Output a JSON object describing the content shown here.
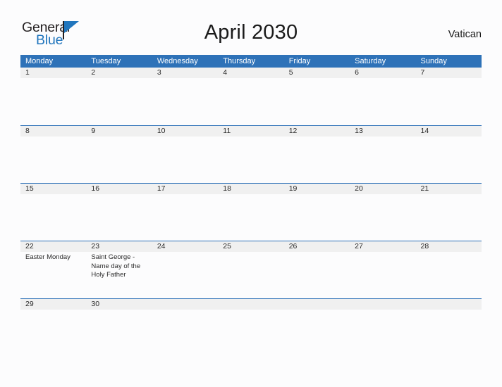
{
  "brand": {
    "name_part1": "General",
    "name_part2": "Blue",
    "flag_icon": "flag-icon"
  },
  "header": {
    "title": "April 2030",
    "country": "Vatican"
  },
  "colors": {
    "header_blue": "#2E72B8",
    "date_band": "#F0F0F0",
    "brand_blue": "#2176BD",
    "page_background": "#FCFCFD",
    "text": "#1A1A1A"
  },
  "calendar": {
    "weekday_headers": [
      "Monday",
      "Tuesday",
      "Wednesday",
      "Thursday",
      "Friday",
      "Saturday",
      "Sunday"
    ],
    "weeks": [
      {
        "days": [
          {
            "date": "1",
            "event": ""
          },
          {
            "date": "2",
            "event": ""
          },
          {
            "date": "3",
            "event": ""
          },
          {
            "date": "4",
            "event": ""
          },
          {
            "date": "5",
            "event": ""
          },
          {
            "date": "6",
            "event": ""
          },
          {
            "date": "7",
            "event": ""
          }
        ]
      },
      {
        "days": [
          {
            "date": "8",
            "event": ""
          },
          {
            "date": "9",
            "event": ""
          },
          {
            "date": "10",
            "event": ""
          },
          {
            "date": "11",
            "event": ""
          },
          {
            "date": "12",
            "event": ""
          },
          {
            "date": "13",
            "event": ""
          },
          {
            "date": "14",
            "event": ""
          }
        ]
      },
      {
        "days": [
          {
            "date": "15",
            "event": ""
          },
          {
            "date": "16",
            "event": ""
          },
          {
            "date": "17",
            "event": ""
          },
          {
            "date": "18",
            "event": ""
          },
          {
            "date": "19",
            "event": ""
          },
          {
            "date": "20",
            "event": ""
          },
          {
            "date": "21",
            "event": ""
          }
        ]
      },
      {
        "days": [
          {
            "date": "22",
            "event": "Easter Monday"
          },
          {
            "date": "23",
            "event": "Saint George - Name day of the Holy Father"
          },
          {
            "date": "24",
            "event": ""
          },
          {
            "date": "25",
            "event": ""
          },
          {
            "date": "26",
            "event": ""
          },
          {
            "date": "27",
            "event": ""
          },
          {
            "date": "28",
            "event": ""
          }
        ]
      },
      {
        "days": [
          {
            "date": "29",
            "event": ""
          },
          {
            "date": "30",
            "event": ""
          },
          {
            "date": "",
            "event": ""
          },
          {
            "date": "",
            "event": ""
          },
          {
            "date": "",
            "event": ""
          },
          {
            "date": "",
            "event": ""
          },
          {
            "date": "",
            "event": ""
          }
        ]
      }
    ]
  }
}
